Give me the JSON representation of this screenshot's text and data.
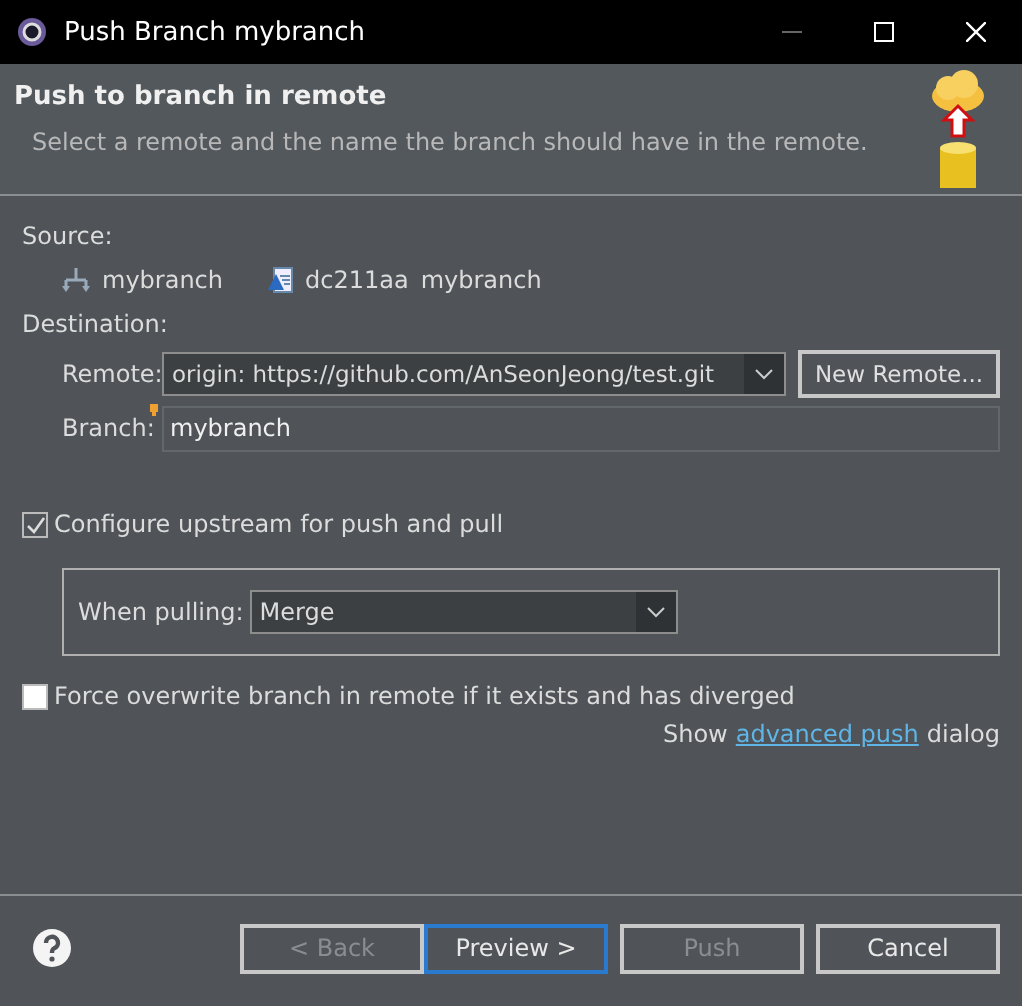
{
  "window": {
    "title": "Push Branch mybranch"
  },
  "header": {
    "title": "Push to branch in remote",
    "description": "Select a remote and the name the branch should have in the remote."
  },
  "source": {
    "label": "Source:",
    "branch": "mybranch",
    "commit": "dc211aa",
    "commit_message": "mybranch"
  },
  "destination": {
    "label": "Destination:",
    "remote_label": "Remote:",
    "remote": "origin: https://github.com/AnSeonJeong/test.git",
    "new_remote_button": "New Remote...",
    "branch_label": "Branch:",
    "branch": "mybranch"
  },
  "configure_upstream": {
    "label": "Configure upstream for push and pull",
    "checked": true
  },
  "pulling": {
    "label": "When pulling:",
    "value": "Merge"
  },
  "force_overwrite": {
    "label": "Force overwrite branch in remote if it exists and has diverged",
    "checked": false
  },
  "advanced": {
    "prefix": "Show",
    "link": "advanced push",
    "suffix": "dialog"
  },
  "buttons": [
    {
      "label": "< Back",
      "disabled": true,
      "default": false
    },
    {
      "label": "Preview >",
      "disabled": false,
      "default": true
    },
    {
      "label": "Push",
      "disabled": true,
      "default": false
    },
    {
      "label": "Cancel",
      "disabled": false,
      "default": false
    }
  ]
}
